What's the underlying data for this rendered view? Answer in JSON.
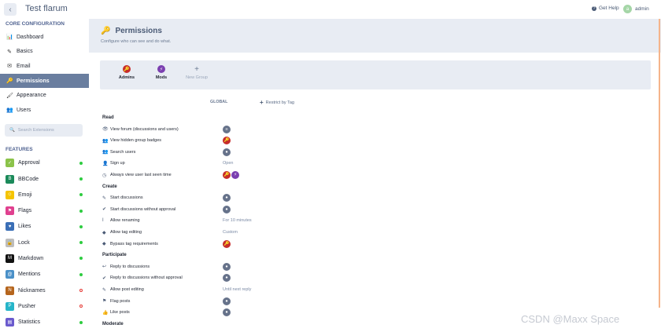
{
  "topbar": {
    "back_icon": "chevron-left-icon",
    "brand": "Test flarum",
    "help": "Get Help",
    "avatar_initial": "a",
    "user": "admin"
  },
  "sidebar": {
    "core_heading": "CORE CONFIGURATION",
    "core_items": [
      {
        "label": "Dashboard",
        "icon": "chart-icon",
        "glyph": "📊"
      },
      {
        "label": "Basics",
        "icon": "pencil-icon",
        "glyph": "✎"
      },
      {
        "label": "Email",
        "icon": "envelope-icon",
        "glyph": "✉"
      },
      {
        "label": "Permissions",
        "icon": "key-icon",
        "glyph": "🔑",
        "active": true
      },
      {
        "label": "Appearance",
        "icon": "paint-brush-icon",
        "glyph": "🖌"
      },
      {
        "label": "Users",
        "icon": "users-icon",
        "glyph": "👥"
      }
    ],
    "search_placeholder": "Search Extensions",
    "features_heading": "FEATURES",
    "extensions": [
      {
        "label": "Approval",
        "color": "#8bc34a",
        "glyph": "✓",
        "enabled": true
      },
      {
        "label": "BBCode",
        "color": "#1b8a5a",
        "glyph": "B",
        "enabled": true
      },
      {
        "label": "Emoji",
        "color": "#f5c400",
        "glyph": "☺",
        "enabled": true
      },
      {
        "label": "Flags",
        "color": "#e0408f",
        "glyph": "⚑",
        "enabled": true
      },
      {
        "label": "Likes",
        "color": "#3b6fb6",
        "glyph": "♥",
        "enabled": true
      },
      {
        "label": "Lock",
        "color": "#bdbdbd",
        "glyph": "🔒",
        "enabled": true
      },
      {
        "label": "Markdown",
        "color": "#111111",
        "glyph": "M",
        "enabled": true
      },
      {
        "label": "Mentions",
        "color": "#4a90c8",
        "glyph": "@",
        "enabled": true
      },
      {
        "label": "Nicknames",
        "color": "#b5651d",
        "glyph": "N",
        "enabled": false
      },
      {
        "label": "Pusher",
        "color": "#26b5c9",
        "glyph": "P",
        "enabled": false
      },
      {
        "label": "Statistics",
        "color": "#6a5acd",
        "glyph": "▤",
        "enabled": true
      }
    ]
  },
  "hero": {
    "title": "Permissions",
    "description": "Configure who can see and do what."
  },
  "groups": [
    {
      "label": "Admins",
      "color": "#c72b2b",
      "glyph": "🔑"
    },
    {
      "label": "Mods",
      "color": "#7b3fb0",
      "glyph": "⚡"
    },
    {
      "label": "New Group",
      "color": "",
      "glyph": "+"
    }
  ],
  "columns": {
    "global": "GLOBAL",
    "restrict": "Restrict by Tag"
  },
  "permissions": [
    {
      "type": "section",
      "label": "Read"
    },
    {
      "label": "View forum (discussions and users)",
      "glyph": "👁",
      "value": "everyone"
    },
    {
      "label": "View hidden group badges",
      "glyph": "👥",
      "value": "admin"
    },
    {
      "label": "Search users",
      "glyph": "👥",
      "value": "members"
    },
    {
      "label": "Sign up",
      "glyph": "👤",
      "value": "text",
      "text": "Open"
    },
    {
      "label": "Always view user last seen time",
      "glyph": "◷",
      "value": "admin_mod"
    },
    {
      "type": "section",
      "label": "Create"
    },
    {
      "label": "Start discussions",
      "glyph": "✎",
      "value": "members"
    },
    {
      "label": "Start discussions without approval",
      "glyph": "✔",
      "value": "members"
    },
    {
      "label": "Allow renaming",
      "glyph": "I",
      "value": "text",
      "text": "For 10 minutes"
    },
    {
      "label": "Allow tag editing",
      "glyph": "◆",
      "value": "text",
      "text": "Custom"
    },
    {
      "label": "Bypass tag requirements",
      "glyph": "◆",
      "value": "admin"
    },
    {
      "type": "section",
      "label": "Participate"
    },
    {
      "label": "Reply to discussions",
      "glyph": "↩",
      "value": "members"
    },
    {
      "label": "Reply to discussions without approval",
      "glyph": "✔",
      "value": "members"
    },
    {
      "label": "Allow post editing",
      "glyph": "✎",
      "value": "text",
      "text": "Until next reply"
    },
    {
      "label": "Flag posts",
      "glyph": "⚑",
      "value": "members"
    },
    {
      "label": "Like posts",
      "glyph": "👍",
      "value": "members"
    },
    {
      "type": "section",
      "label": "Moderate"
    }
  ],
  "watermark": "CSDN @Maxx Space"
}
